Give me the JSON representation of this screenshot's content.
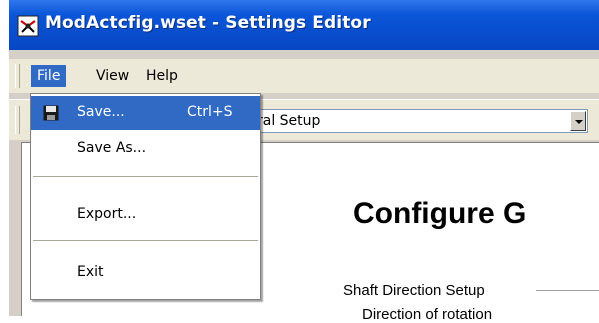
{
  "window": {
    "title": "ModActcfig.wset - Settings Editor"
  },
  "menubar": {
    "file": "File",
    "view": "View",
    "help": "Help"
  },
  "toolbar": {
    "combo_value": "ral Setup"
  },
  "file_menu": {
    "save": {
      "label": "Save...",
      "accelerator": "Ctrl+S"
    },
    "save_as": {
      "label": "Save As..."
    },
    "export": {
      "label": "Export..."
    },
    "exit": {
      "label": "Exit"
    }
  },
  "content": {
    "heading": "Configure G",
    "section_label": "Shaft Direction Setup",
    "partial_label": "Direction of rotation"
  },
  "colors": {
    "titlebar": "#0a55d8",
    "menu_highlight": "#316ac5"
  },
  "icons": {
    "app": "settings-app-icon",
    "save": "floppy-disk-icon",
    "combo": "dropdown-arrow-icon"
  }
}
